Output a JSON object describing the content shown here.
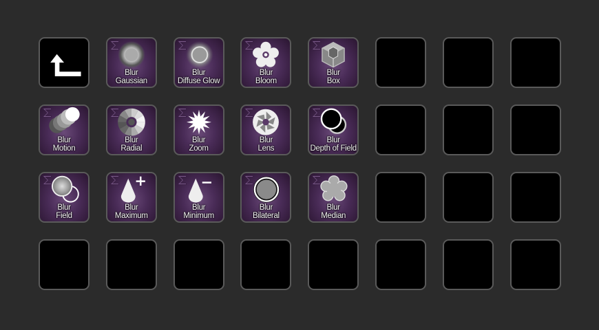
{
  "grid": {
    "columns": 8,
    "rows": 4,
    "keys": [
      {
        "type": "back",
        "name": "back-key",
        "icon": "back-arrow-icon"
      },
      {
        "type": "filter",
        "name": "blur-gaussian-key",
        "icon": "gaussian-blur-icon",
        "line1": "Blur",
        "line2": "Gaussian"
      },
      {
        "type": "filter",
        "name": "blur-diffuse-glow-key",
        "icon": "diffuse-glow-icon",
        "line1": "Blur",
        "line2": "Diffuse Glow"
      },
      {
        "type": "filter",
        "name": "blur-bloom-key",
        "icon": "bloom-flower-icon",
        "line1": "Blur",
        "line2": "Bloom"
      },
      {
        "type": "filter",
        "name": "blur-box-key",
        "icon": "box-cube-icon",
        "line1": "Blur",
        "line2": "Box"
      },
      {
        "type": "empty"
      },
      {
        "type": "empty"
      },
      {
        "type": "empty"
      },
      {
        "type": "filter",
        "name": "blur-motion-key",
        "icon": "motion-circles-icon",
        "line1": "Blur",
        "line2": "Motion"
      },
      {
        "type": "filter",
        "name": "blur-radial-key",
        "icon": "radial-wheel-icon",
        "line1": "Blur",
        "line2": "Radial"
      },
      {
        "type": "filter",
        "name": "blur-zoom-key",
        "icon": "zoom-burst-icon",
        "line1": "Blur",
        "line2": "Zoom"
      },
      {
        "type": "filter",
        "name": "blur-lens-key",
        "icon": "lens-aperture-icon",
        "line1": "Blur",
        "line2": "Lens"
      },
      {
        "type": "filter",
        "name": "blur-depth-of-field-key",
        "icon": "depth-of-field-icon",
        "line1": "Blur",
        "line2": "Depth of Field"
      },
      {
        "type": "empty"
      },
      {
        "type": "empty"
      },
      {
        "type": "empty"
      },
      {
        "type": "filter",
        "name": "blur-field-key",
        "icon": "field-circles-icon",
        "line1": "Blur",
        "line2": "Field"
      },
      {
        "type": "filter",
        "name": "blur-maximum-key",
        "icon": "cone-plus-icon",
        "line1": "Blur",
        "line2": "Maximum"
      },
      {
        "type": "filter",
        "name": "blur-minimum-key",
        "icon": "cone-minus-icon",
        "line1": "Blur",
        "line2": "Minimum"
      },
      {
        "type": "filter",
        "name": "blur-bilateral-key",
        "icon": "bilateral-circle-icon",
        "line1": "Blur",
        "line2": "Bilateral"
      },
      {
        "type": "filter",
        "name": "blur-median-key",
        "icon": "median-flower-icon",
        "line1": "Blur",
        "line2": "Median"
      },
      {
        "type": "empty"
      },
      {
        "type": "empty"
      },
      {
        "type": "empty"
      },
      {
        "type": "empty"
      },
      {
        "type": "empty"
      },
      {
        "type": "empty"
      },
      {
        "type": "empty"
      },
      {
        "type": "empty"
      },
      {
        "type": "empty"
      },
      {
        "type": "empty"
      },
      {
        "type": "empty"
      }
    ]
  },
  "colors": {
    "background": "#2b2b2b",
    "key_border": "#5a5a5a",
    "key_empty": "#000000",
    "filter_purple": "#5a3a68",
    "label_text": "#f2f2f2"
  }
}
